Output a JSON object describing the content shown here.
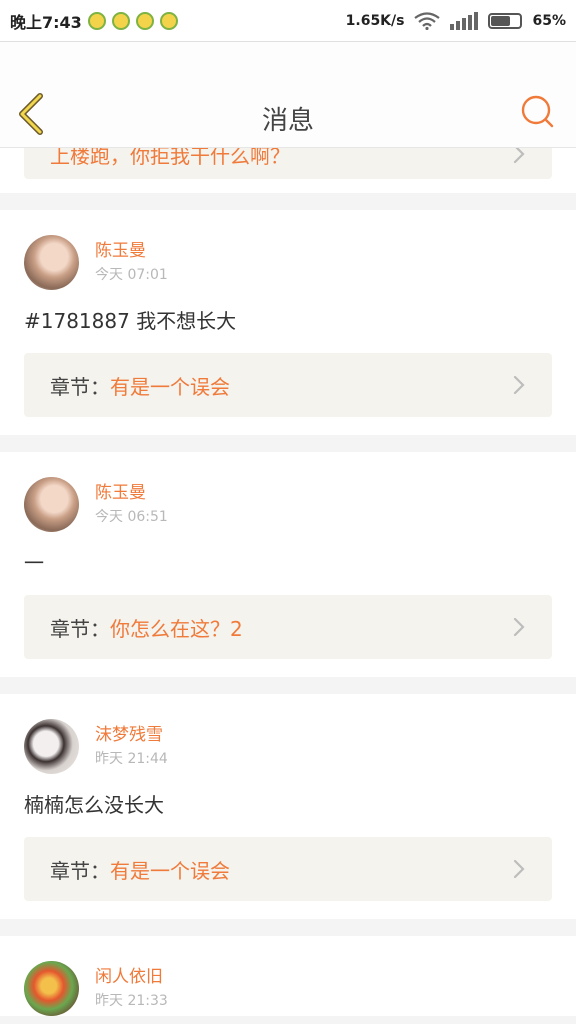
{
  "status_bar": {
    "time": "晚上7:43",
    "speed": "1.65K/s",
    "battery": "65%",
    "battery_level": 0.65
  },
  "header": {
    "title": "消息",
    "back_icon": "chevron-left-icon",
    "search_icon": "search-icon",
    "accent_color": "#f07a3a"
  },
  "partial_card": {
    "chapter_title": "上楼跑，你拒我干什么啊？"
  },
  "messages": [
    {
      "author": "陈玉曼",
      "time": "今天 07:01",
      "content": "#1781887 我不想长大",
      "chapter_label": "章节：",
      "chapter_title": "有是一个误会"
    },
    {
      "author": "陈玉曼",
      "time": "今天 06:51",
      "content": "一",
      "chapter_label": "章节：",
      "chapter_title": "你怎么在这？2"
    },
    {
      "author": "沫梦残雪",
      "time": "昨天 21:44",
      "content": "楠楠怎么没长大",
      "chapter_label": "章节：",
      "chapter_title": "有是一个误会"
    },
    {
      "author": "闲人依旧",
      "time": "昨天 21:33"
    }
  ]
}
